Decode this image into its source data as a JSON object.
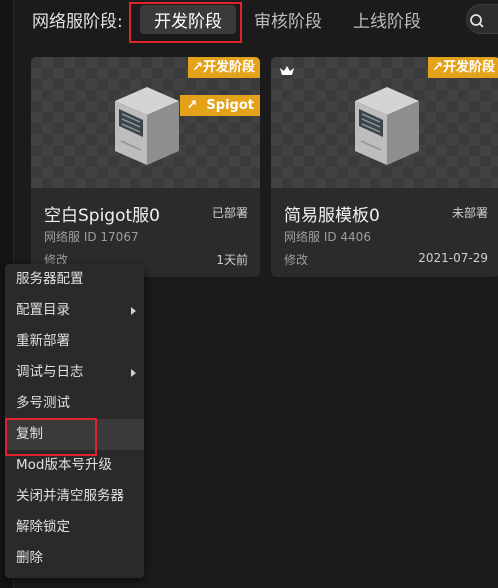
{
  "stage_bar": {
    "label": "网络服阶段:",
    "tabs": [
      {
        "label": "开发阶段",
        "active": true
      },
      {
        "label": "审核阶段",
        "active": false
      },
      {
        "label": "上线阶段",
        "active": false
      }
    ]
  },
  "cards": [
    {
      "stage_tag": "开发阶段",
      "type_tag": "Spigot",
      "title": "空白Spigot服0",
      "status": "已部署",
      "id_text": "网络服 ID 17067",
      "modified_label": "修改",
      "modified_value": "1天前"
    },
    {
      "stage_tag": "开发阶段",
      "title": "简易服模板0",
      "status": "未部署",
      "id_text": "网络服 ID 4406",
      "modified_label": "修改",
      "modified_value": "2021-07-29"
    }
  ],
  "context_menu": {
    "items": [
      {
        "label": "服务器配置",
        "submenu": false
      },
      {
        "label": "配置目录",
        "submenu": true
      },
      {
        "label": "重新部署",
        "submenu": false
      },
      {
        "label": "调试与日志",
        "submenu": true
      },
      {
        "label": "多号测试",
        "submenu": false
      },
      {
        "label": "复制",
        "submenu": false,
        "hovered": true
      },
      {
        "label": "Mod版本号升级",
        "submenu": false
      },
      {
        "label": "关闭并清空服务器",
        "submenu": false
      },
      {
        "label": "解除锁定",
        "submenu": false
      },
      {
        "label": "删除",
        "submenu": false
      }
    ]
  },
  "colors": {
    "background": "#1b1b1b",
    "tag": "#e3a21a",
    "highlight": "#e0242e"
  },
  "icons": {
    "search": "search-icon",
    "crown": "crown-icon",
    "tag_arrow": "arrow-up-right-icon",
    "server": "server-icon",
    "submenu": "chevron-right-icon"
  }
}
